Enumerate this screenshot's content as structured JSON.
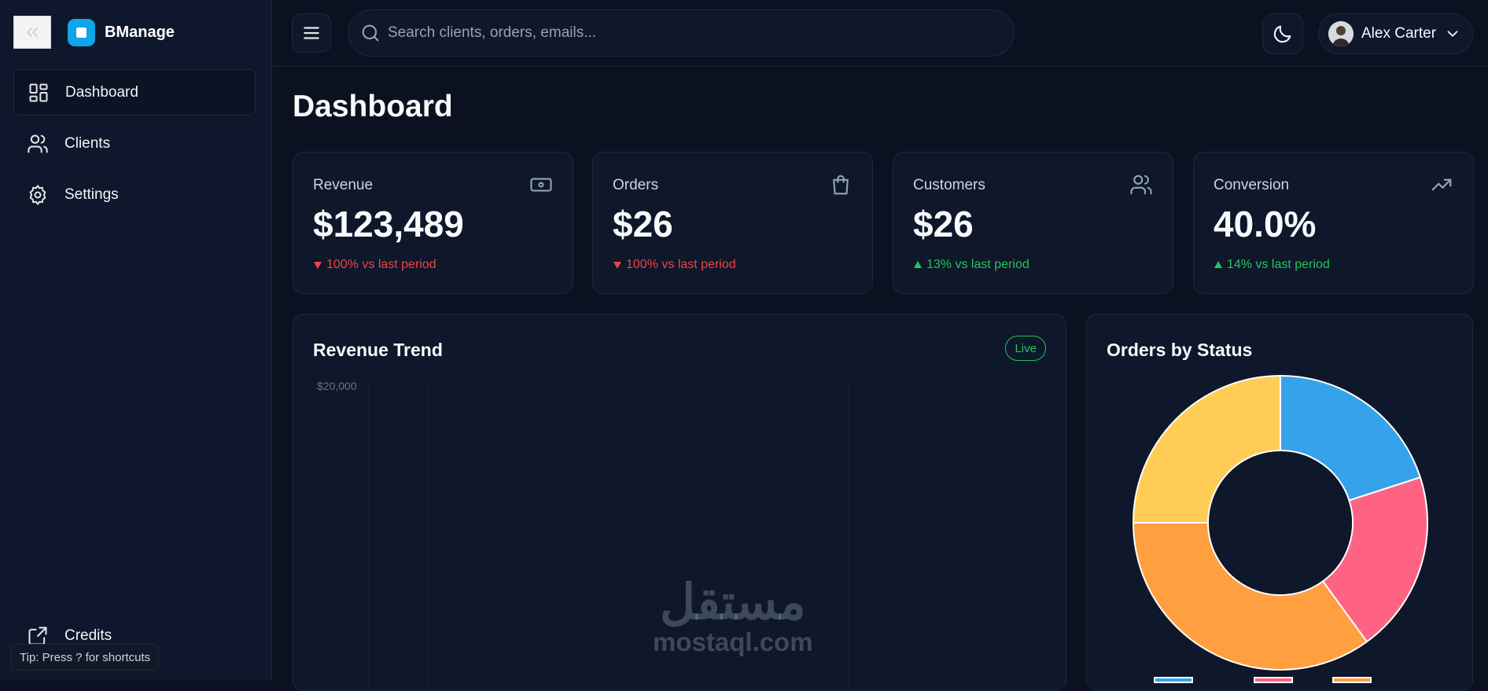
{
  "brand": {
    "name": "BManage"
  },
  "sidebar": {
    "items": [
      {
        "label": "Dashboard",
        "icon": "dashboard-icon",
        "active": true
      },
      {
        "label": "Clients",
        "icon": "users-icon",
        "active": false
      },
      {
        "label": "Settings",
        "icon": "gear-icon",
        "active": false
      }
    ],
    "credits_label": "Credits",
    "tip": "Tip: Press ? for shortcuts"
  },
  "header": {
    "search_placeholder": "Search clients, orders, emails...",
    "user_name": "Alex Carter"
  },
  "page": {
    "title": "Dashboard"
  },
  "stats": [
    {
      "label": "Revenue",
      "value": "$123,489",
      "delta": "100% vs last period",
      "direction": "down",
      "icon": "cash-icon"
    },
    {
      "label": "Orders",
      "value": "$26",
      "delta": "100% vs last period",
      "direction": "down",
      "icon": "shopping-bag-icon"
    },
    {
      "label": "Customers",
      "value": "$26",
      "delta": "13% vs last period",
      "direction": "up",
      "icon": "users-icon"
    },
    {
      "label": "Conversion",
      "value": "40.0%",
      "delta": "14% vs last period",
      "direction": "up",
      "icon": "trending-up-icon"
    }
  ],
  "revenue_panel": {
    "title": "Revenue Trend",
    "badge": "Live",
    "y_tick": "$20,000"
  },
  "orders_panel": {
    "title": "Orders by Status"
  },
  "chart_data": {
    "type": "pie",
    "variant": "doughnut",
    "title": "Orders by Status",
    "values": [
      20,
      20,
      35,
      25
    ],
    "colors": [
      "#36a2eb",
      "#ff6384",
      "#ff9f40",
      "#ffcd56"
    ]
  },
  "watermark": {
    "arabic": "مستقل",
    "latin": "mostaql.com"
  },
  "colors": {
    "background": "#0b1120",
    "panel": "#0f172a",
    "accent": "#0ea5e9",
    "positive": "#22c55e",
    "negative": "#ef4444"
  }
}
